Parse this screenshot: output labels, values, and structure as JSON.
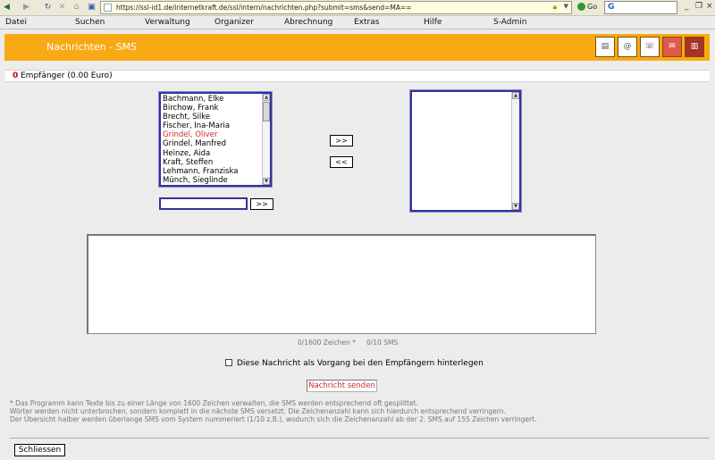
{
  "browser": {
    "url": "https://ssl-id1.de/internetkraft.de/ssl/intern/nachrichten.php?submit=sms&send=MA==",
    "go_label": "Go"
  },
  "menu": {
    "items": [
      "Datei",
      "Suchen",
      "Verwaltung",
      "Organizer",
      "Abrechnung",
      "Extras",
      "Hilfe",
      "S-Admin"
    ]
  },
  "header": {
    "title": "Nachrichten - SMS",
    "icons": [
      "notes-icon",
      "email-icon",
      "phone-icon",
      "sms-icon",
      "trash-icon"
    ],
    "accent_color": "#f9a915"
  },
  "recipients": {
    "count": "0",
    "label": "Empfänger (0.00 Euro)"
  },
  "contacts": {
    "items": [
      {
        "name": "Bachmann, Elke",
        "highlight": false
      },
      {
        "name": "Birchow, Frank",
        "highlight": false
      },
      {
        "name": "Brecht, Silke",
        "highlight": false
      },
      {
        "name": "Fischer, Ina-Maria",
        "highlight": false
      },
      {
        "name": "Grindel, Oliver",
        "highlight": true
      },
      {
        "name": "Grindel, Manfred",
        "highlight": false
      },
      {
        "name": "Heinze, Aida",
        "highlight": false
      },
      {
        "name": "Kraft, Steffen",
        "highlight": false
      },
      {
        "name": "Lehmann, Franziska",
        "highlight": false
      },
      {
        "name": "Münch, Sieglinde",
        "highlight": false
      }
    ],
    "filter_value": "",
    "filter_add_label": ">>"
  },
  "transfer": {
    "add_label": ">>",
    "remove_label": "<<"
  },
  "message": {
    "text": "",
    "char_counter": "0/1600 Zeichen *",
    "sms_counter": "0/10 SMS"
  },
  "archive_option": {
    "checked": false,
    "label": "Diese Nachricht als Vorgang bei den Empfängern hinterlegen"
  },
  "send_label": "Nachricht senden",
  "footnotes": [
    "* Das Programm kann Texte bis zu einer Länge von 1600 Zeichen verwalten, die SMS werden entsprechend oft gesplittet.",
    "Wörter werden nicht unterbrochen, sondern komplett in die nächste SMS versetzt. Die Zeichenanzahl kann sich hierdurch entsprechend verringern.",
    "Der Übersicht halber werden überlange SMS vom System nummeriert (1/10 z.B.), wodurch sich die Zeichenanzahl ab der 2. SMS auf 155 Zeichen verringert."
  ],
  "close_label": "Schliessen"
}
